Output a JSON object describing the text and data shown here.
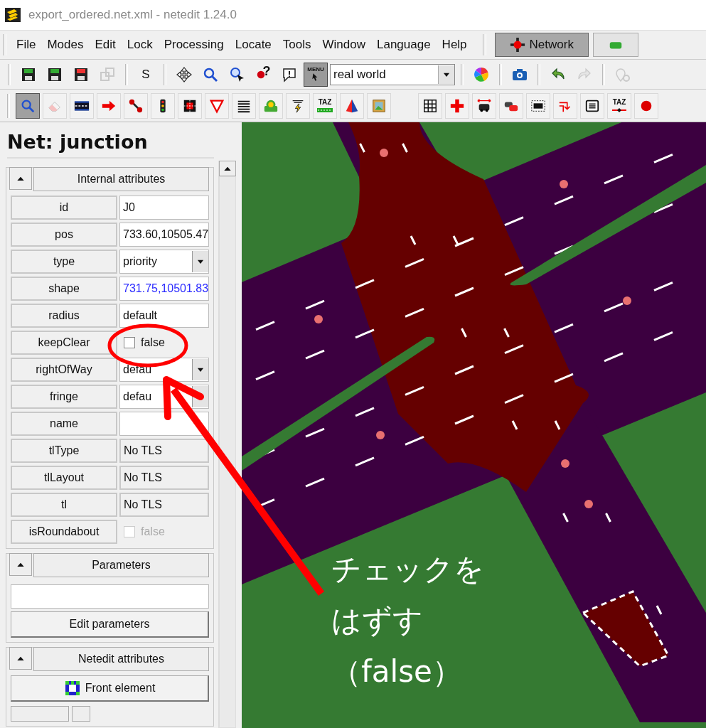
{
  "window": {
    "title": "export_ordered.net.xml - netedit 1.24.0"
  },
  "menu": [
    "File",
    "Modes",
    "Edit",
    "Lock",
    "Processing",
    "Locate",
    "Tools",
    "Window",
    "Language",
    "Help"
  ],
  "supermodes": [
    {
      "label": "Network",
      "selected": true
    },
    {
      "selected": false
    }
  ],
  "toolbar": [
    {
      "kind": "icon",
      "disabled": false
    },
    {
      "kind": "icon",
      "disabled": false
    },
    {
      "kind": "icon",
      "disabled": false
    },
    {
      "kind": "icon",
      "disabled": true
    },
    {
      "kind": "text",
      "label": "S"
    },
    {
      "kind": "icon",
      "disabled": false
    },
    {
      "kind": "icon",
      "disabled": false
    },
    {
      "kind": "icon",
      "disabled": false
    },
    {
      "kind": "help",
      "label": "?"
    },
    {
      "kind": "icon",
      "disabled": false
    },
    {
      "kind": "icon",
      "disabled": false,
      "label": "MENU"
    },
    {
      "kind": "dropdown",
      "value": "real world"
    },
    {
      "kind": "icon",
      "disabled": false
    },
    {
      "kind": "icon",
      "disabled": false
    },
    {
      "kind": "icon",
      "disabled": false
    },
    {
      "kind": "icon",
      "disabled": true
    },
    {
      "kind": "icon",
      "disabled": true
    }
  ],
  "edit_modes": [
    {
      "selected": true
    },
    {
      "selected": false
    },
    {
      "selected": false
    },
    {
      "selected": false
    },
    {
      "selected": false
    },
    {
      "selected": false
    },
    {
      "selected": false
    },
    {
      "selected": false
    },
    {
      "selected": false
    },
    {
      "selected": false
    },
    {
      "selected": false
    },
    {
      "selected": false,
      "label": "TAZ"
    },
    {
      "selected": false
    },
    {
      "selected": false
    }
  ],
  "view_modes": [
    {
      "selected": false
    },
    {
      "selected": false
    },
    {
      "selected": false
    },
    {
      "selected": false
    },
    {
      "selected": false
    },
    {
      "selected": false
    },
    {
      "selected": false
    },
    {
      "selected": false,
      "label": "TAZ"
    },
    {
      "selected": false
    }
  ],
  "inspector": {
    "title": "Net: junction",
    "internal": {
      "title": "Internal attributes",
      "attributes": [
        {
          "name": "id",
          "kind": "text",
          "value": "J0",
          "highlighted": false
        },
        {
          "name": "pos",
          "kind": "text",
          "value": "733.60,10505.47",
          "highlighted": false
        },
        {
          "name": "type",
          "kind": "dropdown",
          "value": "priority",
          "highlighted": false
        },
        {
          "name": "shape",
          "kind": "text",
          "value": "731.75,10501.83",
          "highlighted": true
        },
        {
          "name": "radius",
          "kind": "text",
          "value": "default",
          "highlighted": false
        },
        {
          "name": "keepClear",
          "kind": "checkbox",
          "value": "false",
          "checked": false,
          "disabled": false
        },
        {
          "name": "rightOfWay",
          "kind": "dropdown",
          "value": "defau",
          "highlighted": false
        },
        {
          "name": "fringe",
          "kind": "dropdown",
          "value": "defau",
          "highlighted": false
        },
        {
          "name": "name",
          "kind": "text"
        },
        {
          "name": "tlType",
          "kind": "readonly",
          "value": "No TLS"
        },
        {
          "name": "tlLayout",
          "kind": "readonly",
          "value": "No TLS"
        },
        {
          "name": "tl",
          "kind": "readonly",
          "value": "No TLS"
        },
        {
          "name": "isRoundabout",
          "kind": "checkbox",
          "value": "false",
          "checked": false,
          "disabled": true
        }
      ]
    },
    "parameters": {
      "title": "Parameters",
      "button": "Edit parameters"
    },
    "netedit": {
      "title": "Netedit attributes",
      "button": "Front element"
    }
  },
  "annotation": {
    "lines": [
      "チェックを",
      "はずす",
      "（false）"
    ]
  }
}
